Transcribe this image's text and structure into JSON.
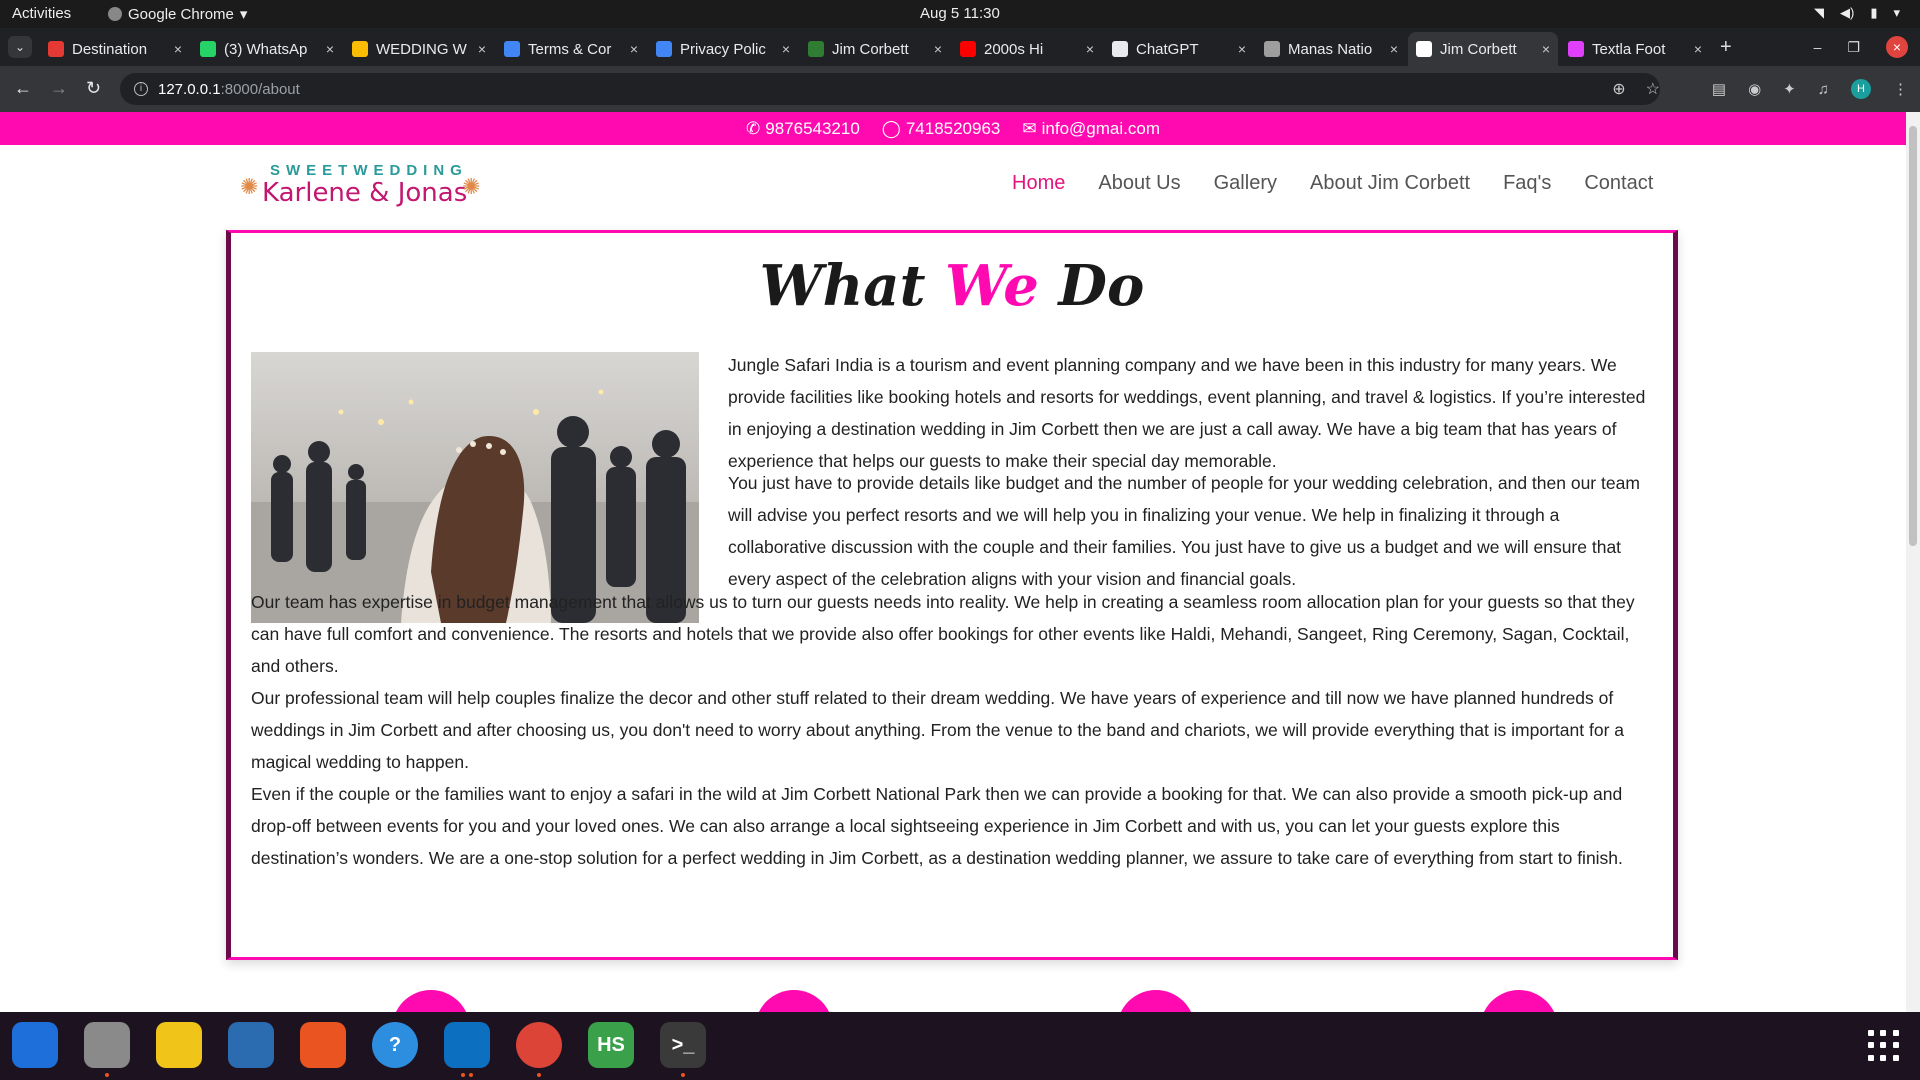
{
  "system": {
    "activities": "Activities",
    "app_name": "Google Chrome",
    "clock": "Aug 5  11:30"
  },
  "tabs": [
    {
      "title": "Destination",
      "favicon_color": "#e53935",
      "active": false
    },
    {
      "title": "(3) WhatsAp",
      "favicon_color": "#25d366",
      "active": false
    },
    {
      "title": "WEDDING W",
      "favicon_color": "#fbbc04",
      "active": false
    },
    {
      "title": "Terms & Cor",
      "favicon_color": "#4285f4",
      "active": false
    },
    {
      "title": "Privacy Polic",
      "favicon_color": "#4285f4",
      "active": false
    },
    {
      "title": "Jim Corbett",
      "favicon_color": "#2e7d32",
      "active": false
    },
    {
      "title": "2000s Hi",
      "favicon_color": "#ff0000",
      "active": false
    },
    {
      "title": "ChatGPT",
      "favicon_color": "#e8eaed",
      "active": false
    },
    {
      "title": "Manas Natio",
      "favicon_color": "#9e9e9e",
      "active": false
    },
    {
      "title": "Jim Corbett",
      "favicon_color": "#ffffff",
      "active": true
    },
    {
      "title": "Textla Foot",
      "favicon_color": "#e040fb",
      "active": false
    }
  ],
  "address_bar": {
    "host": "127.0.0.1",
    "path": ":8000/about"
  },
  "contact": {
    "phone": "9876543210",
    "whatsapp": "7418520963",
    "email": "info@gmai.com"
  },
  "logo": {
    "top_text": "SWEETWEDDING",
    "names": "Karlene & Jonas"
  },
  "nav": [
    {
      "label": "Home",
      "active": true
    },
    {
      "label": "About Us",
      "active": false
    },
    {
      "label": "Gallery",
      "active": false
    },
    {
      "label": "About Jim Corbett",
      "active": false
    },
    {
      "label": "Faq's",
      "active": false
    },
    {
      "label": "Contact",
      "active": false
    }
  ],
  "heading": {
    "part1": "What ",
    "accent": "We",
    "part2": " Do"
  },
  "paragraphs": {
    "p1": "Jungle Safari India is a tourism and event planning company and we have been in this industry for many years. We provide facilities like booking hotels and resorts for weddings, event planning, and travel & logistics. If you’re interested in enjoying a destination wedding in Jim Corbett then we are just a call away. We have a big team that has years of experience that helps our guests to make their special day memorable.",
    "p2": "You just have to provide details like budget and the number of people for your wedding celebration, and then our team will advise you perfect resorts and we will help you in finalizing your venue. We help in finalizing it through a collaborative discussion with the couple and their families. You just have to give us a budget and we will ensure that every aspect of the celebration aligns with your vision and financial goals.",
    "p3": "Our team has expertise in budget management that allows us to turn our guests needs into reality. We help in creating a seamless room allocation plan for your guests so that they can have full comfort and convenience. The resorts and hotels that we provide also offer bookings for other events like Haldi, Mehandi, Sangeet, Ring Ceremony, Sagan, Cocktail, and others.",
    "p4": "Our professional team will help couples finalize the decor and other stuff related to their dream wedding. We have years of experience and till now we have planned hundreds of weddings in Jim Corbett and after choosing us, you don't need to worry about anything. From the venue to the band and chariots, we will provide everything that is important for a magical wedding to happen.",
    "p5": "Even if the couple or the families want to enjoy a safari in the wild at Jim Corbett National Park then we can provide a booking for that. We can also provide a smooth pick-up and drop-off between events for you and your loved ones. We can also arrange a local sightseeing experience in Jim Corbett and with us, you can let your guests explore this destination’s wonders. We are a one-stop solution for a perfect wedding in Jim Corbett, as a destination wedding planner, we assure to take care of everything from start to finish."
  },
  "colors": {
    "accent_pink": "#ff0ab0",
    "border_plum": "#6b0a4a",
    "nav_active": "#e3147f"
  },
  "dock": [
    {
      "name": "thunderbird-icon",
      "color": "#1e6fd9",
      "label": ""
    },
    {
      "name": "files-icon",
      "color": "#8a8a8a",
      "label": ""
    },
    {
      "name": "rhythmbox-icon",
      "color": "#f0c419",
      "label": ""
    },
    {
      "name": "writer-icon",
      "color": "#2b6cb0",
      "label": ""
    },
    {
      "name": "software-icon",
      "color": "#e95420",
      "label": ""
    },
    {
      "name": "help-icon",
      "color": "#2d8ee0",
      "label": "?"
    },
    {
      "name": "vscode-icon",
      "color": "#0d6fc0",
      "label": ""
    },
    {
      "name": "chrome-icon",
      "color": "#db4437",
      "label": ""
    },
    {
      "name": "hs-icon",
      "color": "#3aa04a",
      "label": "HS"
    },
    {
      "name": "terminal-icon",
      "color": "#3a3a3a",
      "label": ">_"
    }
  ]
}
